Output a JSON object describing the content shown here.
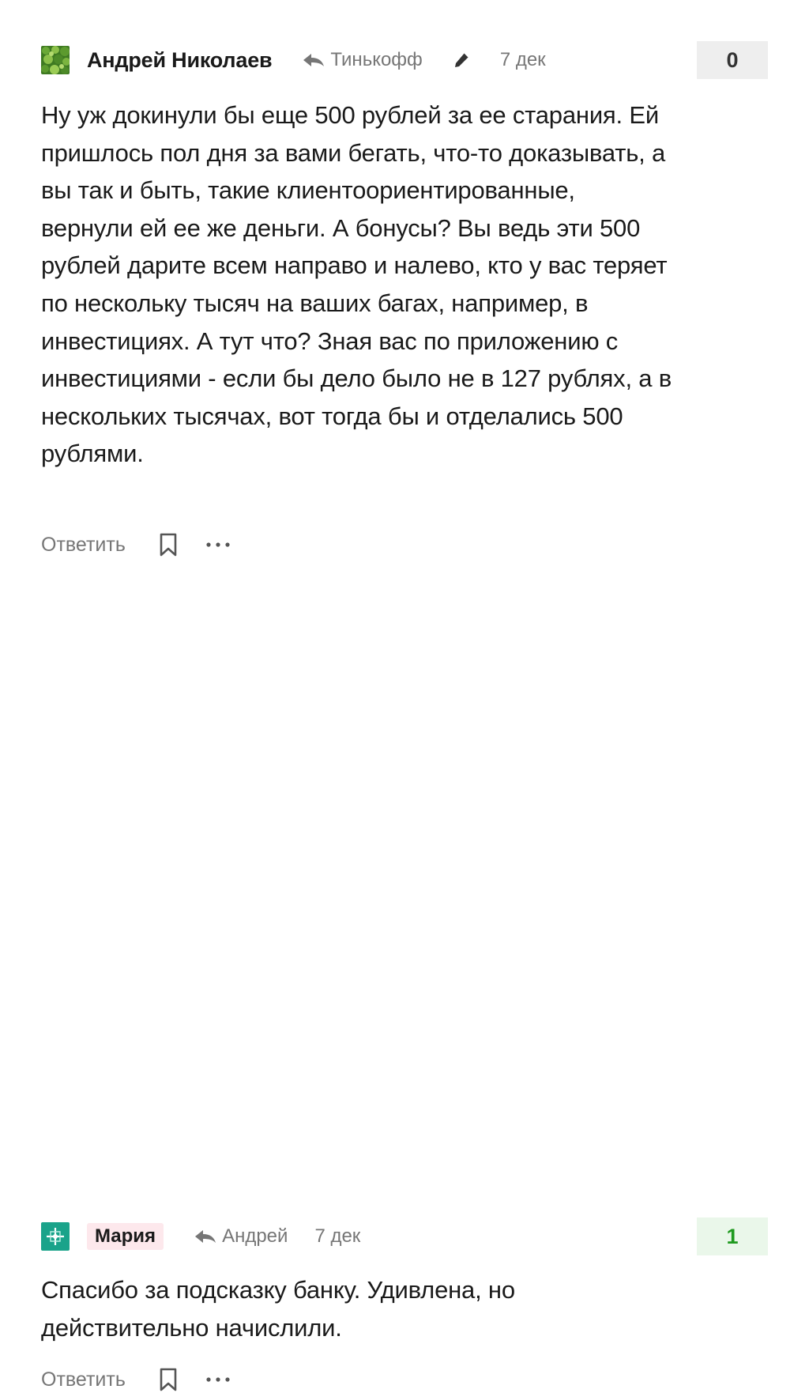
{
  "comments": [
    {
      "author": "Андрей Николаев",
      "reply_to": "Тинькофф",
      "edited": true,
      "date": "7 дек",
      "score": "0",
      "avatar_icon": "moss-green-avatar",
      "text": "Ну уж докинули бы еще 500 рублей за ее старания. Ей пришлось пол дня за вами бегать, что-то доказывать, а вы так и быть, такие клиентоориентированные, вернули ей ее же деньги. А бонусы? Вы ведь эти 500 рублей дарите всем направо и налево, кто у вас теряет по нескольку тысяч на ваших багах, например, в инвестициях. А тут что? Зная вас по приложению с инвестициями - если бы дело было не в 127 рублях, а в нескольких тысячах, вот тогда бы и отделались 500 рублями.",
      "reply_label": "Ответить"
    },
    {
      "author": "Мария",
      "reply_to": "Андрей",
      "date": "7 дек",
      "score": "1",
      "avatar_icon": "teal-pattern-avatar",
      "text": "Спасибо за подсказку банку. Удивлена, но действительно начислили.",
      "reply_label": "Ответить"
    }
  ],
  "colors": {
    "positive_score": "#1f9a1f",
    "positive_score_bg": "#eaf7ea",
    "neutral_score_bg": "#eeeeee",
    "author_badge_bg": "#fde8ec",
    "muted_text": "#767676"
  }
}
